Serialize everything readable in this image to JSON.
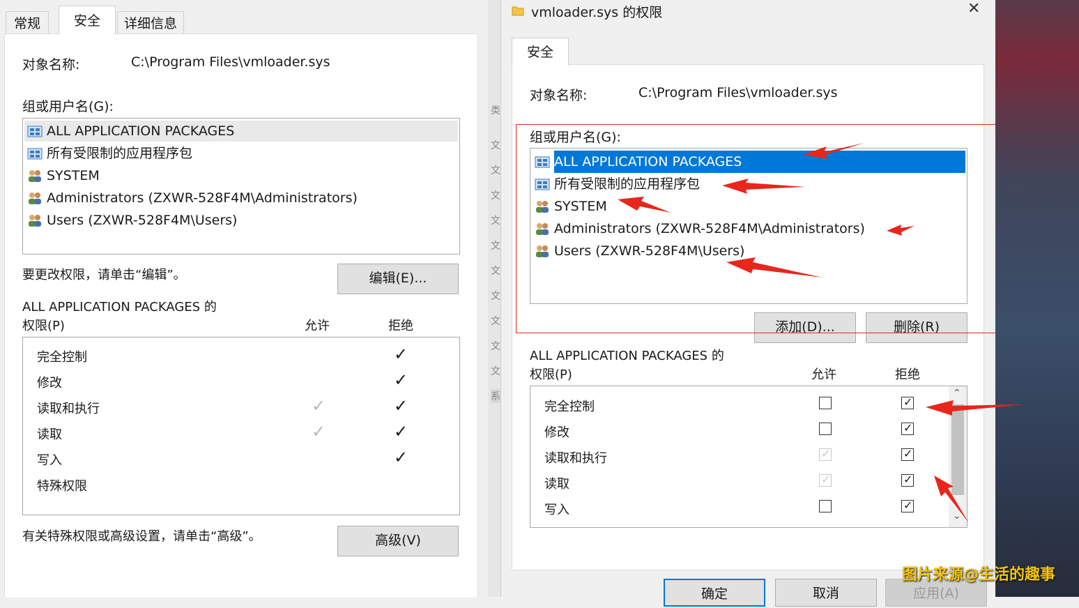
{
  "left": {
    "tabs": [
      {
        "label": "常规"
      },
      {
        "label": "安全"
      },
      {
        "label": "详细信息"
      }
    ],
    "object_name_label": "对象名称:",
    "object_name_value": "C:\\Program Files\\vmloader.sys",
    "group_label": "组或用户名(G):",
    "users": [
      {
        "label": "ALL APPLICATION PACKAGES",
        "icon": "package-icon"
      },
      {
        "label": "所有受限制的应用程序包",
        "icon": "package-icon"
      },
      {
        "label": "SYSTEM",
        "icon": "user-group-icon"
      },
      {
        "label": "Administrators (ZXWR-528F4M\\Administrators)",
        "icon": "user-group-icon"
      },
      {
        "label": "Users (ZXWR-528F4M\\Users)",
        "icon": "user-group-icon"
      }
    ],
    "change_hint": "要更改权限，请单击“编辑”。",
    "edit_button": "编辑(E)...",
    "perm_title_1": "ALL APPLICATION PACKAGES 的",
    "perm_title_2": "权限(P)",
    "allow_header": "允许",
    "deny_header": "拒绝",
    "permissions": [
      {
        "name": "完全控制",
        "allow": "",
        "deny": "✓"
      },
      {
        "name": "修改",
        "allow": "",
        "deny": "✓"
      },
      {
        "name": "读取和执行",
        "allow": "✓",
        "deny": "✓"
      },
      {
        "name": "读取",
        "allow": "✓",
        "deny": "✓"
      },
      {
        "name": "写入",
        "allow": "",
        "deny": "✓"
      },
      {
        "name": "特殊权限",
        "allow": "",
        "deny": ""
      }
    ],
    "advanced_hint": "有关特殊权限或高级设置，请单击“高级”。",
    "advanced_button": "高级(V)"
  },
  "right": {
    "title": "vmloader.sys 的权限",
    "close_symbol": "✕",
    "tab": "安全",
    "object_name_label": "对象名称:",
    "object_name_value": "C:\\Program Files\\vmloader.sys",
    "group_label": "组或用户名(G):",
    "users": [
      {
        "label": "ALL APPLICATION PACKAGES",
        "icon": "package-icon",
        "selected": true
      },
      {
        "label": "所有受限制的应用程序包",
        "icon": "package-icon"
      },
      {
        "label": "SYSTEM",
        "icon": "user-group-icon"
      },
      {
        "label": "Administrators (ZXWR-528F4M\\Administrators)",
        "icon": "user-group-icon"
      },
      {
        "label": "Users (ZXWR-528F4M\\Users)",
        "icon": "user-group-icon"
      }
    ],
    "add_button": "添加(D)...",
    "remove_button": "删除(R)",
    "perm_title_1": "ALL APPLICATION PACKAGES 的",
    "perm_title_2": "权限(P)",
    "allow_header": "允许",
    "deny_header": "拒绝",
    "permissions": [
      {
        "name": "完全控制",
        "allow": false,
        "allow_disabled": false,
        "deny": true
      },
      {
        "name": "修改",
        "allow": false,
        "allow_disabled": false,
        "deny": true
      },
      {
        "name": "读取和执行",
        "allow": true,
        "allow_disabled": true,
        "deny": true
      },
      {
        "name": "读取",
        "allow": true,
        "allow_disabled": true,
        "deny": true
      },
      {
        "name": "写入",
        "allow": false,
        "allow_disabled": false,
        "deny": true
      }
    ],
    "ok_button": "确定",
    "cancel_button": "取消",
    "apply_button": "应用(A)",
    "accent_color": "#0078d7",
    "annotation_color": "#e8261c"
  },
  "watermark": "图片来源@生活的趣事",
  "side_strip_chars": [
    "类",
    "文",
    "文",
    "文",
    "文",
    "文",
    "文",
    "文",
    "文",
    "文",
    "文",
    "文",
    "系"
  ]
}
